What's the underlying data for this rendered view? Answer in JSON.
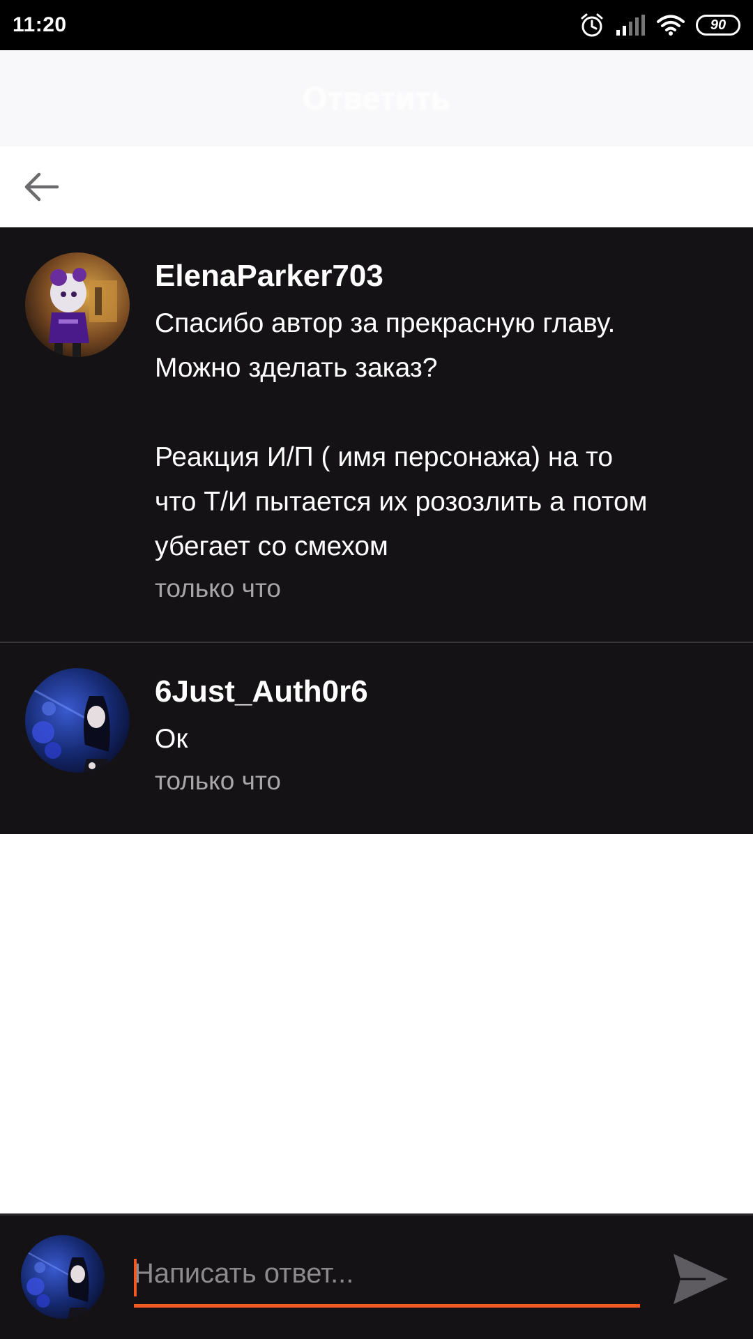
{
  "status_bar": {
    "time": "11:20",
    "battery": "90"
  },
  "header": {
    "title": "Ответить"
  },
  "comments": [
    {
      "username": "ElenaParker703",
      "text": "Спасибо автор за прекрасную главу.\nМожно зделать заказ?\n\nРеакция И/П ( имя персонажа) на то\nчто Т/И пытается их розозлить а потом\nубегает со смехом",
      "time": "только что"
    },
    {
      "username": "6Just_Auth0r6",
      "text": "Ок",
      "time": "только что"
    }
  ],
  "reply": {
    "placeholder": "Написать ответ..."
  },
  "colors": {
    "accent": "#f05a22",
    "dark_bg": "#141215",
    "muted_text": "#a8a6a9"
  }
}
